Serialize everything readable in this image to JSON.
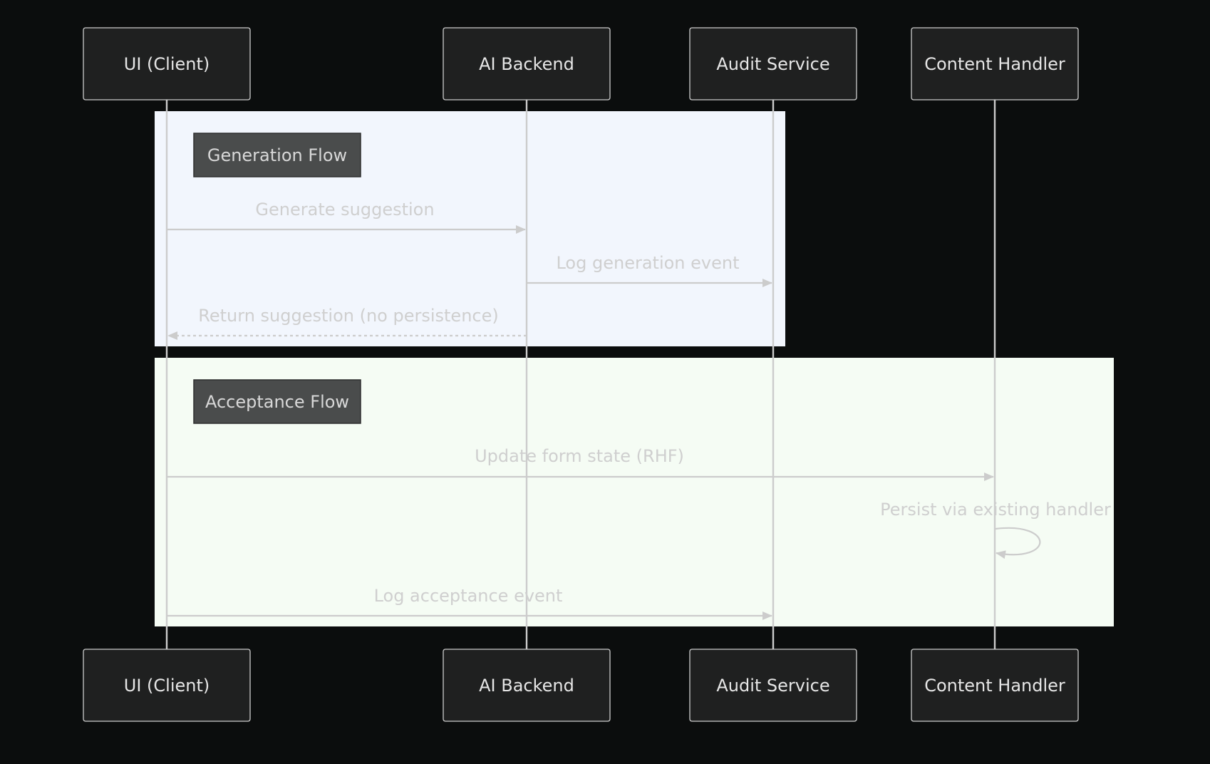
{
  "diagram": {
    "type": "sequence",
    "colors": {
      "background": "#0b0d0d",
      "generation_section": "#f2f6fd",
      "acceptance_section": "#f5fcf4",
      "actor_fill": "#1f2020",
      "line": "#cccccc"
    },
    "participants": [
      {
        "id": "ui",
        "label": "UI (Client)"
      },
      {
        "id": "ai",
        "label": "AI Backend"
      },
      {
        "id": "audit",
        "label": "Audit Service"
      },
      {
        "id": "content",
        "label": "Content Handler"
      }
    ],
    "sections": [
      {
        "label": "Generation Flow",
        "color": "#f2f6fd",
        "messages": [
          {
            "from": "ui",
            "to": "ai",
            "label": "Generate suggestion",
            "style": "solid"
          },
          {
            "from": "ai",
            "to": "audit",
            "label": "Log generation event",
            "style": "solid"
          },
          {
            "from": "ai",
            "to": "ui",
            "label": "Return suggestion (no persistence)",
            "style": "dashed"
          }
        ]
      },
      {
        "label": "Acceptance Flow",
        "color": "#f5fcf4",
        "messages": [
          {
            "from": "ui",
            "to": "content",
            "label": "Update form state (RHF)",
            "style": "solid"
          },
          {
            "from": "content",
            "to": "content",
            "label": "Persist via existing handler",
            "style": "self"
          },
          {
            "from": "ui",
            "to": "audit",
            "label": "Log acceptance event",
            "style": "solid"
          }
        ]
      }
    ]
  }
}
